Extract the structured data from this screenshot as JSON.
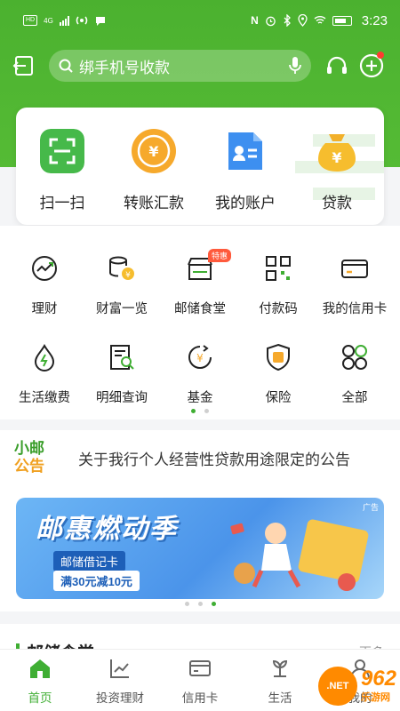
{
  "colors": {
    "brand_green": "#4bb12f",
    "accent_orange": "#f0a020",
    "active_tab": "#3fae33"
  },
  "status_bar": {
    "left_badge": "HD",
    "network": "4G",
    "time": "3:23",
    "icons": [
      "nfc-icon",
      "alarm-icon",
      "bluetooth-icon",
      "location-icon",
      "wifi-icon",
      "battery-icon"
    ]
  },
  "header": {
    "search_placeholder": "绑手机号收款",
    "icons": [
      "exit-icon",
      "search-icon",
      "mic-icon",
      "headset-icon",
      "plus-icon"
    ]
  },
  "quick_actions": [
    {
      "label": "扫一扫",
      "icon": "scan-icon"
    },
    {
      "label": "转账汇款",
      "icon": "transfer-icon"
    },
    {
      "label": "我的账户",
      "icon": "account-icon"
    },
    {
      "label": "贷款",
      "icon": "loan-icon"
    }
  ],
  "service_grid": {
    "row1": [
      {
        "label": "理财",
        "icon": "chart-icon"
      },
      {
        "label": "财富一览",
        "icon": "coins-icon"
      },
      {
        "label": "邮储食堂",
        "icon": "shop-icon",
        "tag": "特惠"
      },
      {
        "label": "付款码",
        "icon": "qrcode-icon"
      },
      {
        "label": "我的信用卡",
        "icon": "credit-card-icon"
      }
    ],
    "row2": [
      {
        "label": "生活缴费",
        "icon": "utility-icon"
      },
      {
        "label": "明细查询",
        "icon": "details-icon"
      },
      {
        "label": "基金",
        "icon": "fund-icon"
      },
      {
        "label": "保险",
        "icon": "insurance-icon"
      },
      {
        "label": "全部",
        "icon": "all-icon"
      }
    ],
    "page_index": 1,
    "page_count": 2
  },
  "notice": {
    "logo_top": "小邮",
    "logo_bottom": "公告",
    "text": "关于我行个人经营性贷款用途限定的公告"
  },
  "banner": {
    "title": "邮惠燃动季",
    "subtitle": "邮储借记卡",
    "offer": "满30元减10元",
    "ad_tag": "广告",
    "page_index": 3,
    "page_count": 3
  },
  "section": {
    "title": "邮储食堂",
    "more": "更多"
  },
  "tabbar": [
    {
      "label": "首页",
      "icon": "home-icon",
      "active": true
    },
    {
      "label": "投资理财",
      "icon": "investment-icon",
      "active": false
    },
    {
      "label": "信用卡",
      "icon": "card-icon",
      "active": false
    },
    {
      "label": "生活",
      "icon": "life-icon",
      "active": false
    },
    {
      "label": "我的",
      "icon": "profile-icon",
      "active": false
    }
  ],
  "watermark": {
    "number": "962",
    "name": "乐游网",
    "domain": ".NET"
  }
}
